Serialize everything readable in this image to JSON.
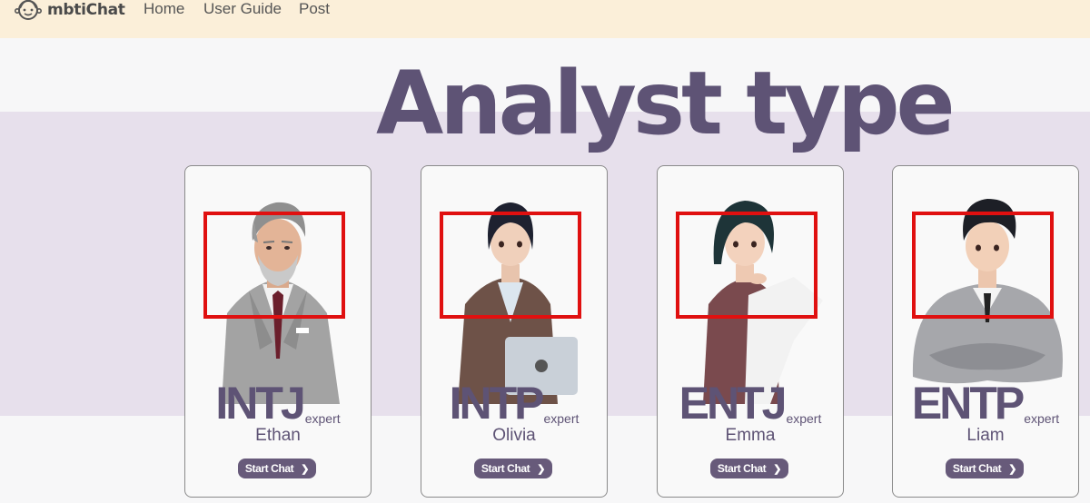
{
  "nav": {
    "brand": "mbtiChat",
    "links": [
      "Home",
      "User Guide",
      "Post"
    ]
  },
  "page": {
    "title": "Analyst type"
  },
  "cards": [
    {
      "type": "INTJ",
      "sub": "expert",
      "name": "Ethan",
      "button": "Start Chat"
    },
    {
      "type": "INTP",
      "sub": "expert",
      "name": "Olivia",
      "button": "Start Chat"
    },
    {
      "type": "ENTJ",
      "sub": "expert",
      "name": "Emma",
      "button": "Start Chat"
    },
    {
      "type": "ENTP",
      "sub": "expert",
      "name": "Liam",
      "button": "Start Chat"
    }
  ],
  "colors": {
    "nav_bg": "#fbefd9",
    "accent": "#5e5375",
    "band": "#e7e0ec",
    "button": "#675a7a",
    "highlight": "#e01010"
  },
  "icons": {
    "brand": "smiling-face-logo-icon",
    "chevron": "chevron-right-icon"
  }
}
